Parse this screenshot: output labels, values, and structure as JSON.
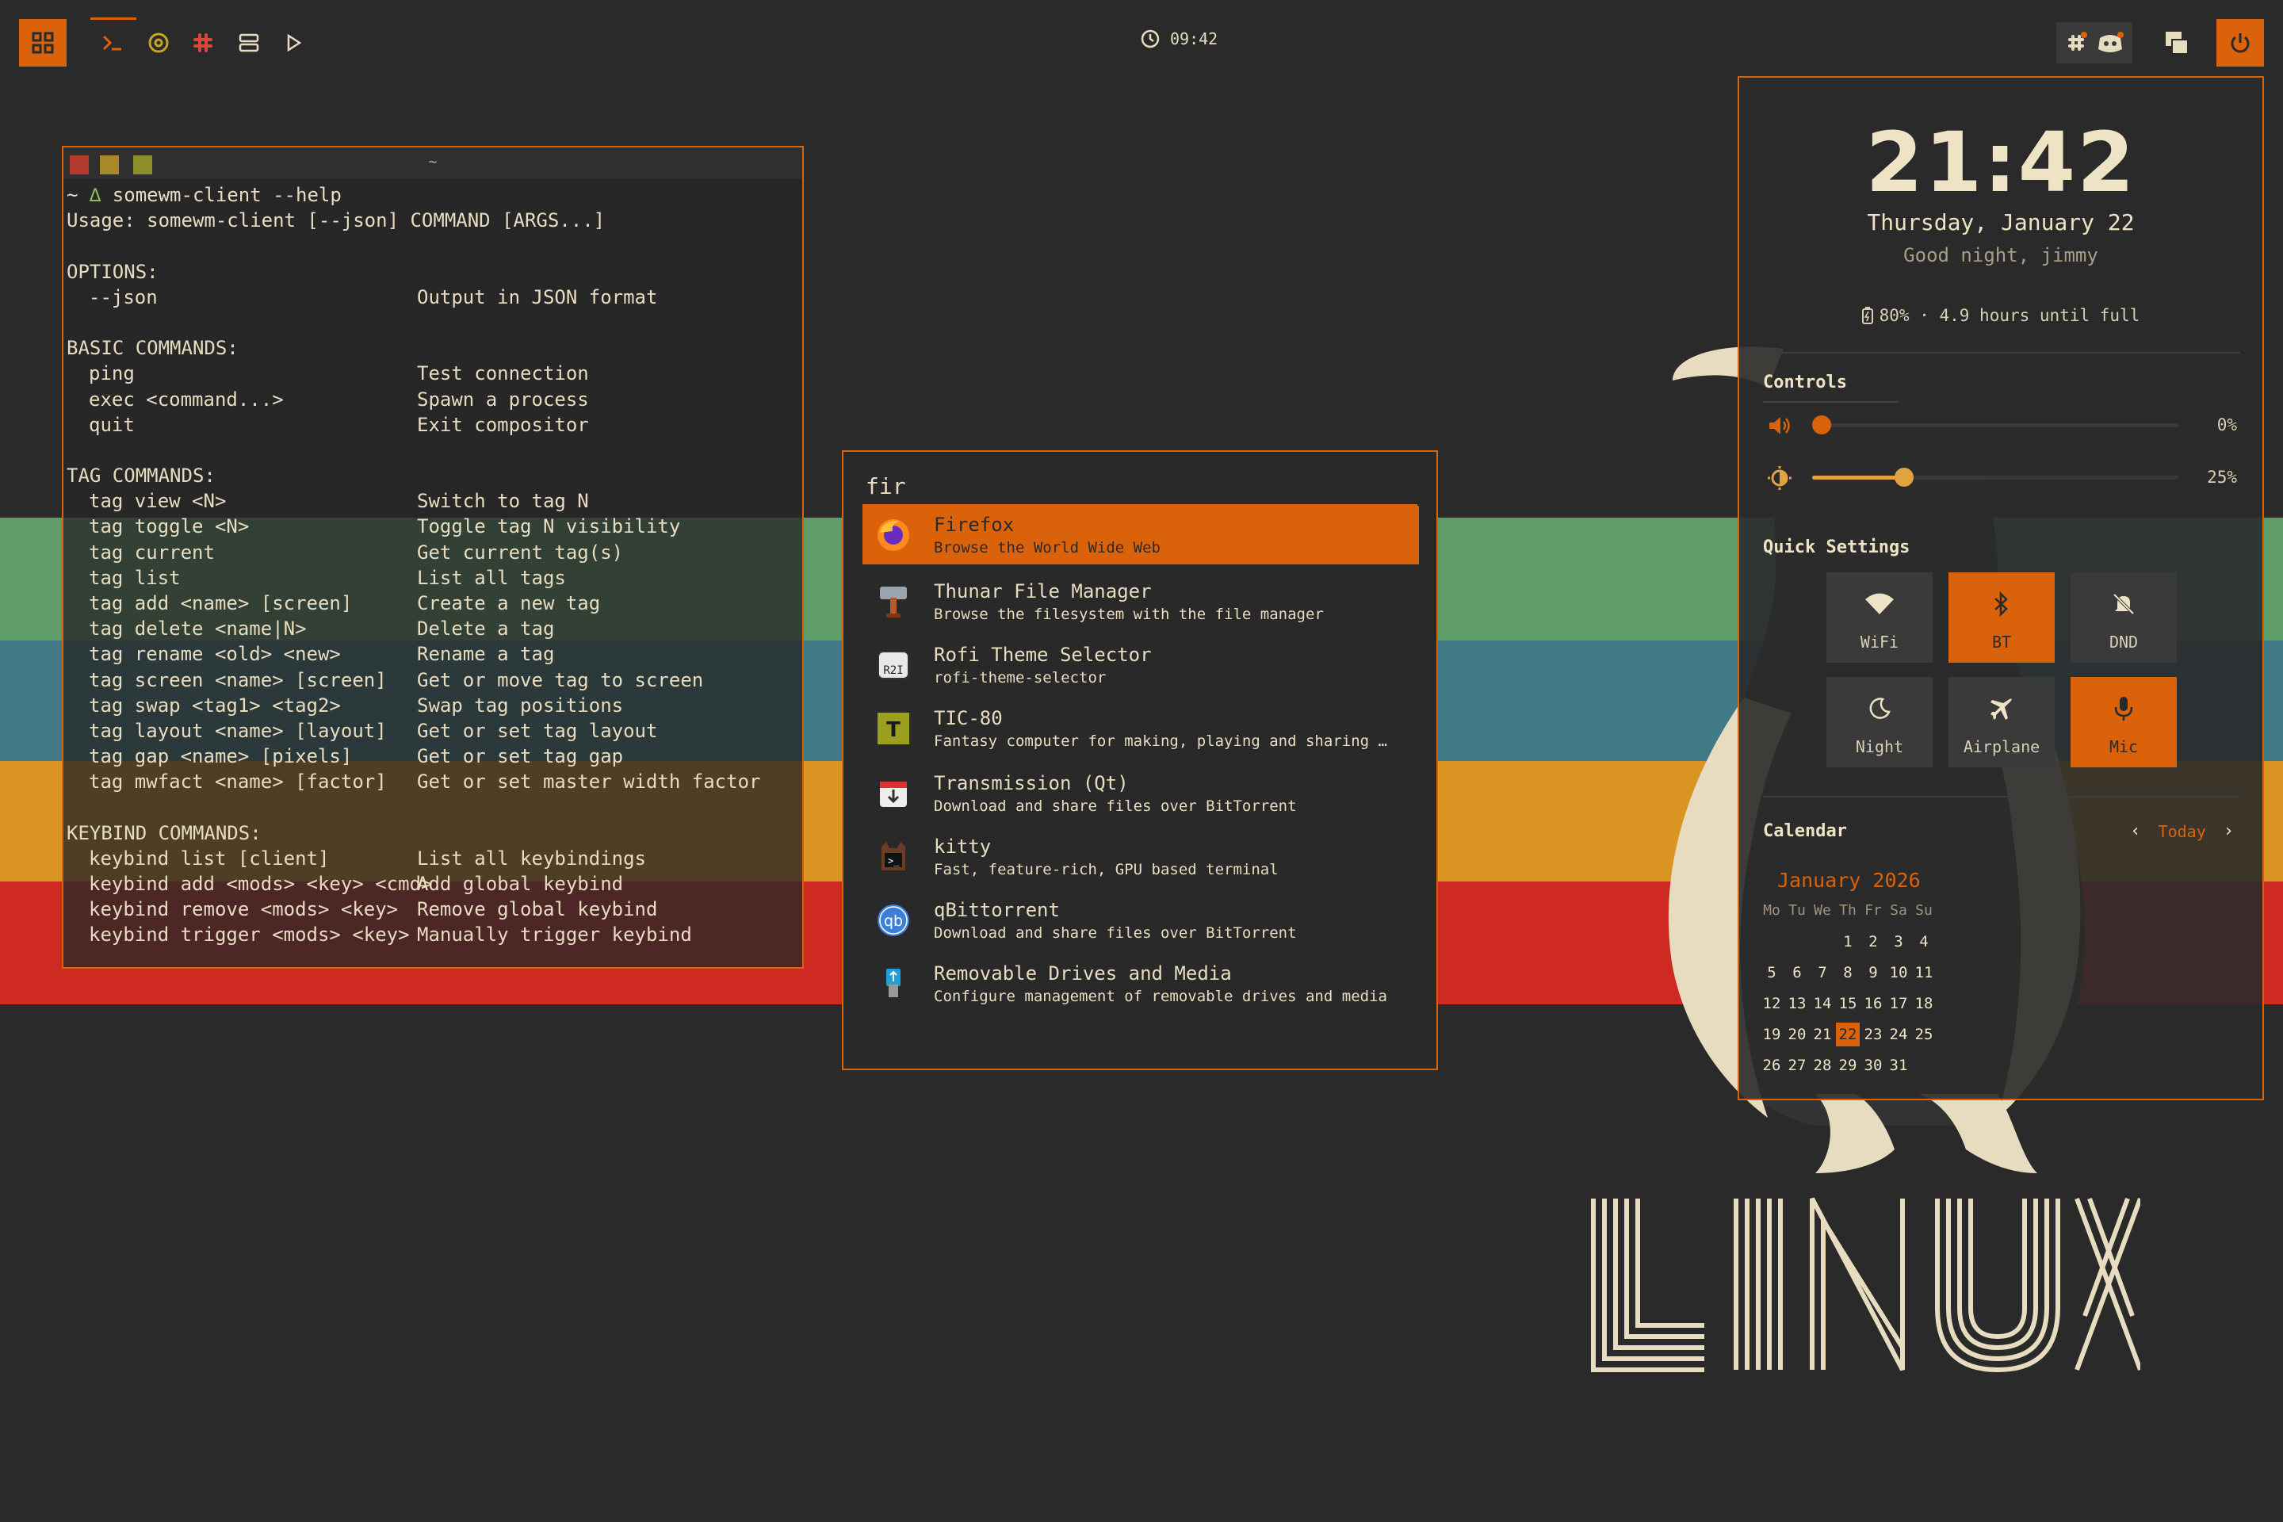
{
  "topbar": {
    "clock": "09:42",
    "icons": [
      "launcher-grid-icon",
      "terminal-icon",
      "chrome-icon",
      "slack-icon",
      "server-icon",
      "play-icon"
    ]
  },
  "terminal": {
    "title": "~",
    "prompt": "~ ",
    "prompt_symbol": "∆",
    "command": " somewm-client --help",
    "usage": "Usage: somewm-client [--json] COMMAND [ARGS...]",
    "sections": [
      {
        "heading": "OPTIONS:",
        "rows": [
          [
            "--json",
            "Output in JSON format"
          ]
        ]
      },
      {
        "heading": "BASIC COMMANDS:",
        "rows": [
          [
            "ping",
            "Test connection"
          ],
          [
            "exec <command...>",
            "Spawn a process"
          ],
          [
            "quit",
            "Exit compositor"
          ]
        ]
      },
      {
        "heading": "TAG COMMANDS:",
        "rows": [
          [
            "tag view <N>",
            "Switch to tag N"
          ],
          [
            "tag toggle <N>",
            "Toggle tag N visibility"
          ],
          [
            "tag current",
            "Get current tag(s)"
          ],
          [
            "tag list",
            "List all tags"
          ],
          [
            "tag add <name> [screen]",
            "Create a new tag"
          ],
          [
            "tag delete <name|N>",
            "Delete a tag"
          ],
          [
            "tag rename <old> <new>",
            "Rename a tag"
          ],
          [
            "tag screen <name> [screen]",
            "Get or move tag to screen"
          ],
          [
            "tag swap <tag1> <tag2>",
            "Swap tag positions"
          ],
          [
            "tag layout <name> [layout]",
            "Get or set tag layout"
          ],
          [
            "tag gap <name> [pixels]",
            "Get or set tag gap"
          ],
          [
            "tag mwfact <name> [factor]",
            "Get or set master width factor"
          ]
        ]
      },
      {
        "heading": "KEYBIND COMMANDS:",
        "rows": [
          [
            "keybind list [client]",
            "List all keybindings"
          ],
          [
            "keybind add <mods> <key> <cmd>",
            "Add global keybind"
          ],
          [
            "keybind remove <mods> <key>",
            "Remove global keybind"
          ],
          [
            "keybind trigger <mods> <key>",
            "Manually trigger keybind"
          ]
        ]
      }
    ]
  },
  "rofi": {
    "query": "fir",
    "items": [
      {
        "name": "Firefox",
        "desc": "Browse the World Wide Web",
        "icon": "firefox-icon",
        "selected": true
      },
      {
        "name": "Thunar File Manager",
        "desc": "Browse the filesystem with the file manager",
        "icon": "file-manager-icon"
      },
      {
        "name": "Rofi Theme Selector",
        "desc": "rofi-theme-selector",
        "icon": "rofi-icon"
      },
      {
        "name": "TIC-80",
        "desc": "Fantasy computer for making, playing and sharing …",
        "icon": "tic80-icon"
      },
      {
        "name": "Transmission (Qt)",
        "desc": "Download and share files over BitTorrent",
        "icon": "transmission-icon"
      },
      {
        "name": "kitty",
        "desc": "Fast, feature-rich, GPU based terminal",
        "icon": "kitty-icon"
      },
      {
        "name": "qBittorrent",
        "desc": "Download and share files over BitTorrent",
        "icon": "qbittorrent-icon"
      },
      {
        "name": "Removable Drives and Media",
        "desc": "Configure management of removable drives and media",
        "icon": "usb-drive-icon"
      }
    ]
  },
  "panel": {
    "clock": "21:42",
    "date": "Thursday, January 22",
    "greeting": "Good night, jimmy",
    "battery": "80% · 4.9 hours until full",
    "controls_title": "Controls",
    "volume_pct": "0%",
    "volume_value": 0.0,
    "brightness_pct": "25%",
    "brightness_value": 0.25,
    "quick_title": "Quick Settings",
    "quick": [
      {
        "label": "WiFi",
        "icon": "wifi-icon",
        "on": false
      },
      {
        "label": "BT",
        "icon": "bluetooth-icon",
        "on": true
      },
      {
        "label": "DND",
        "icon": "bell-off-icon",
        "on": false
      },
      {
        "label": "Night",
        "icon": "moon-icon",
        "on": false
      },
      {
        "label": "Airplane",
        "icon": "airplane-icon",
        "on": false
      },
      {
        "label": "Mic",
        "icon": "mic-icon",
        "on": true
      }
    ],
    "calendar_title": "Calendar",
    "calendar_today_btn": "Today",
    "calendar_month": "January 2026",
    "weekdays": [
      "Mo",
      "Tu",
      "We",
      "Th",
      "Fr",
      "Sa",
      "Su"
    ],
    "first_weekday_index": 3,
    "days_in_month": 31,
    "today": 22
  },
  "wallpaper": {
    "word": "LINUX"
  },
  "colors": {
    "accent": "#d9620b",
    "bg": "#2a2a2a",
    "fg": "#e8dcc0"
  }
}
